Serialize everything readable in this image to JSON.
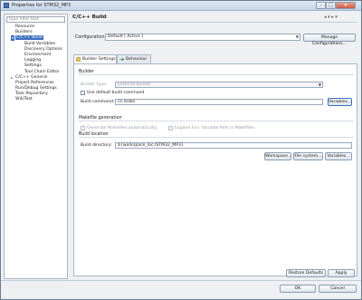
{
  "window": {
    "title": "Properties for STM32_MP3"
  },
  "filter": {
    "placeholder": "type filter text"
  },
  "tree": [
    {
      "label": "Resource",
      "level": 1
    },
    {
      "label": "Builders",
      "level": 1
    },
    {
      "label": "C/C++ Build",
      "level": 1,
      "selected": true
    },
    {
      "label": "Build Variables",
      "level": 2
    },
    {
      "label": "Discovery Options",
      "level": 2
    },
    {
      "label": "Environment",
      "level": 2
    },
    {
      "label": "Logging",
      "level": 2
    },
    {
      "label": "Settings",
      "level": 2
    },
    {
      "label": "Tool Chain Editor",
      "level": 2
    },
    {
      "label": "C/C++ General",
      "level": 1
    },
    {
      "label": "Project References",
      "level": 1
    },
    {
      "label": "Run/Debug Settings",
      "level": 1
    },
    {
      "label": "Task Repository",
      "level": 1
    },
    {
      "label": "WikiText",
      "level": 1
    }
  ],
  "page": {
    "title": "C/C++ Build"
  },
  "configuration": {
    "label": "Configuration:",
    "value": "Default  [ Active ]",
    "manage_button": "Manage Configurations..."
  },
  "tabs": [
    {
      "label": "Builder Settings",
      "active": true
    },
    {
      "label": "Behaviour",
      "active": false
    }
  ],
  "builder": {
    "group_title": "Builder",
    "type_label": "Builder type:",
    "type_value": "External builder",
    "use_default_label": "Use default build command",
    "command_label": "Build command:",
    "command_value": "cs-make",
    "variables_button": "Variables..."
  },
  "makefile": {
    "group_title": "Makefile generation",
    "generate_label": "Generate Makefiles automatically",
    "expand_label": "Expand Env. Variable Refs in Makefiles"
  },
  "build_location": {
    "group_title": "Build location",
    "dir_label": "Build directory:",
    "dir_value": "${workspace_loc:/STM32_MP3}",
    "workspace_button": "Workspace...",
    "filesystem_button": "File system...",
    "variables_button": "Variables..."
  },
  "buttons": {
    "restore_defaults": "Restore Defaults",
    "apply": "Apply",
    "ok": "OK",
    "cancel": "Cancel"
  }
}
